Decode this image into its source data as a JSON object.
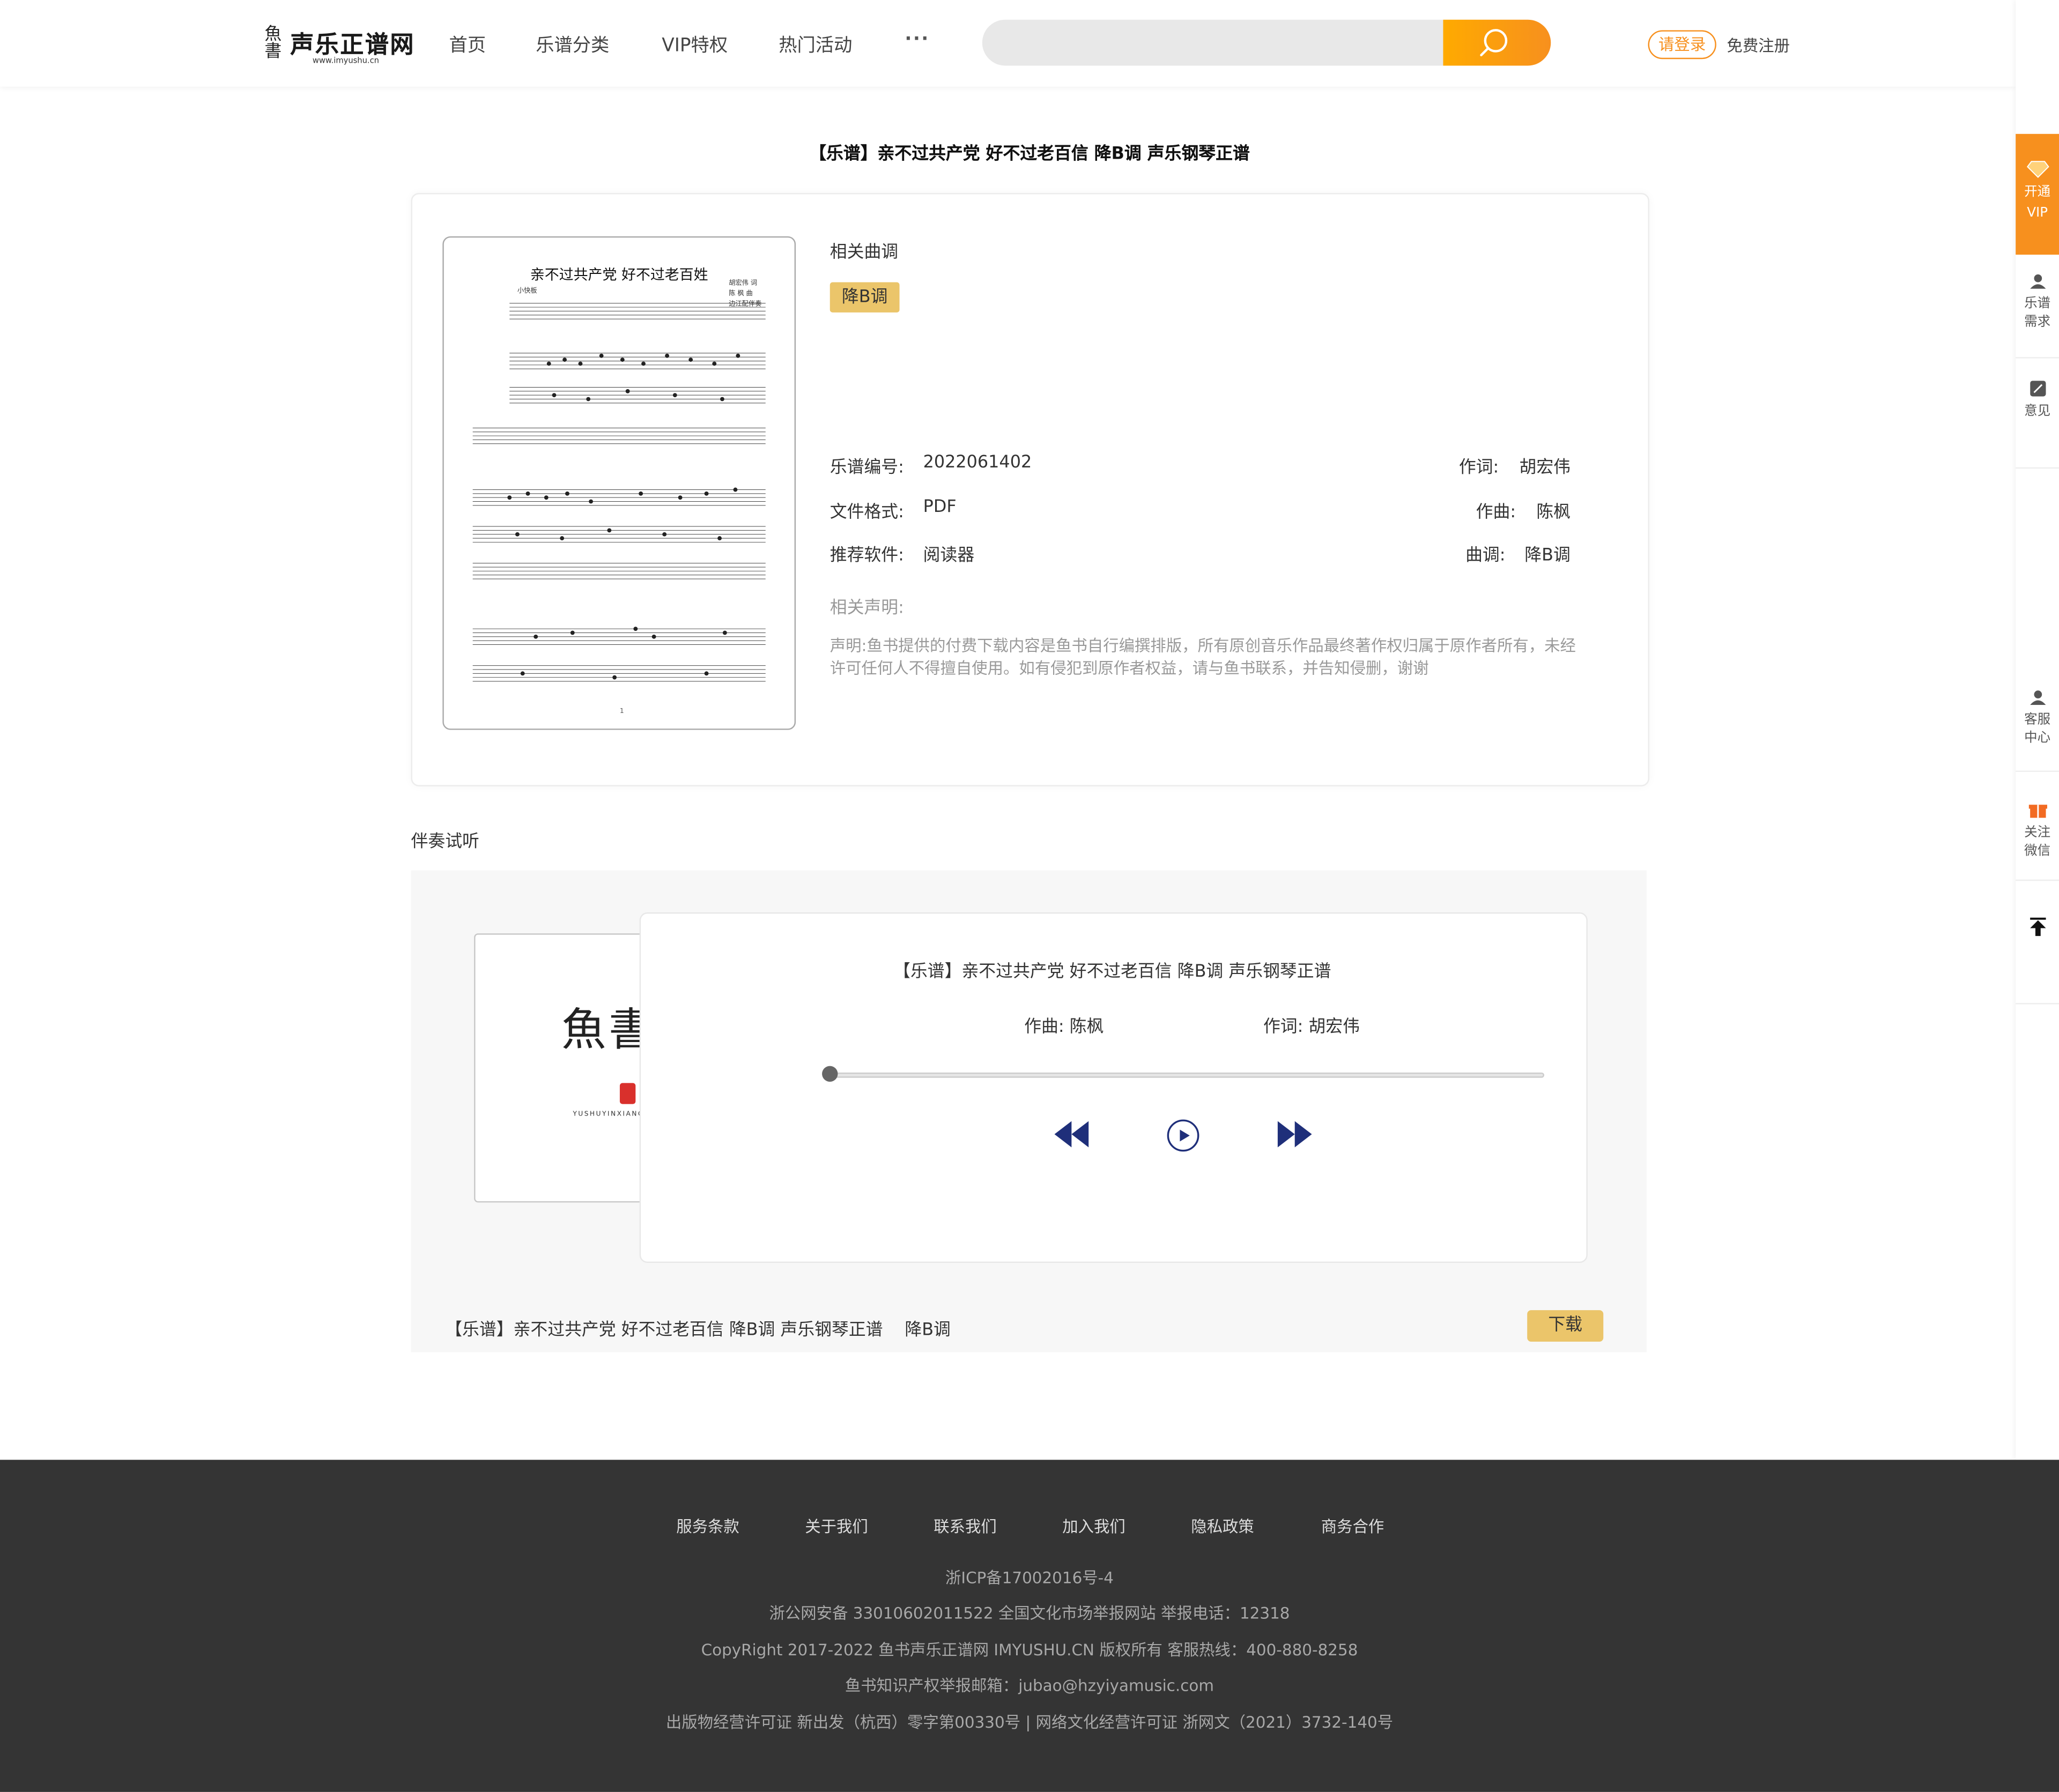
{
  "header": {
    "logo_text": "声乐正谱网",
    "logo_url": "www.imyushu.cn",
    "nav": [
      "首页",
      "乐谱分类",
      "VIP特权",
      "热门活动"
    ],
    "more": "···",
    "search_placeholder": "",
    "login": "请登录",
    "register": "免费注册"
  },
  "score": {
    "title": "【乐谱】亲不过共产党 好不过老百信 降B调 声乐钢琴正谱",
    "thumb_title": "亲不过共产党  好不过老百姓",
    "thumb_tempo": "小快板",
    "thumb_credits": [
      "胡宏伟 词",
      "陈  枫 曲",
      "边江配伴奏"
    ],
    "related_key_label": "相关曲调",
    "key_tag": "降B调",
    "fields": {
      "number_label": "乐谱编号:",
      "number": "2022061402",
      "format_label": "文件格式:",
      "format": "PDF",
      "software_label": "推荐软件:",
      "software": "阅读器",
      "lyricist_label": "作词:",
      "lyricist": "胡宏伟",
      "composer_label": "作曲:",
      "composer": "陈枫",
      "key_label": "曲调:",
      "key": "降B调"
    },
    "statement_label": "相关声明:",
    "statement": "声明:鱼书提供的付费下载内容是鱼书自行编撰排版，所有原创音乐作品最终著作权归属于原作者所有，未经许可任何人不得擅自使用。如有侵犯到原作者权益，请与鱼书联系，并告知侵删，谢谢"
  },
  "player": {
    "section_title": "伴奏试听",
    "cover_glyphs": "魚書",
    "cover_brand": "YUSHUYINXIANG",
    "track_title": "【乐谱】亲不过共产党 好不过老百信 降B调 声乐钢琴正谱",
    "composer": "作曲: 陈枫",
    "lyricist": "作词: 胡宏伟",
    "progress": 0,
    "bottom_title": "【乐谱】亲不过共产党 好不过老百信 降B调 声乐钢琴正谱",
    "bottom_key": "降B调",
    "download": "下载",
    "accent_color": "#1f2f7a"
  },
  "rail": {
    "vip": [
      "开通",
      "VIP"
    ],
    "demand": [
      "乐谱",
      "需求"
    ],
    "feedback": [
      "意见"
    ],
    "service": [
      "客服",
      "中心"
    ],
    "wechat": [
      "关注",
      "微信"
    ]
  },
  "footer": {
    "links": [
      "服务条款",
      "关于我们",
      "联系我们",
      "加入我们",
      "隐私政策",
      "商务合作"
    ],
    "lines": [
      "浙ICP备17002016号-4",
      "浙公网安备 33010602011522 全国文化市场举报网站 举报电话：12318",
      "CopyRight  2017-2022 鱼书声乐正谱网 IMYUSHU.CN 版权所有 客服热线：400-880-8258",
      "鱼书知识产权举报邮箱：jubao@hzyiyamusic.com",
      "出版物经营许可证 新出发（杭西）零字第00330号 | 网络文化经营许可证 浙网文（2021）3732-140号"
    ]
  },
  "colors": {
    "brand_orange": "#f7901e",
    "tag_gold": "#ebc56a",
    "footer_bg": "#343434"
  }
}
